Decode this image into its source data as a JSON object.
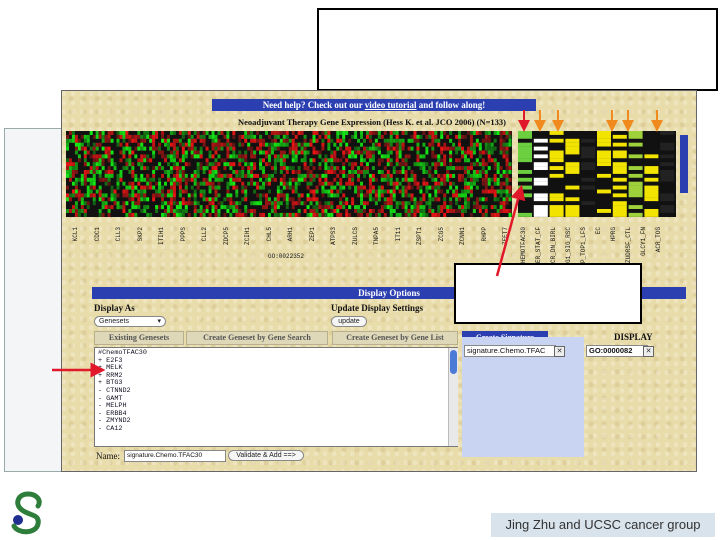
{
  "help_bar": {
    "prefix": "Need help? Check out our ",
    "link": "video tutorial",
    "suffix": " and follow along!"
  },
  "heatmap_title": "Neoadjuvant Therapy Gene Expression (Hess K. et al. JCO 2006) (N=133)",
  "heatmap_labels": [
    "KCL1",
    "CDC1",
    "CLL3",
    "SKP2",
    "ITIH1",
    "PPPS",
    "CLL2",
    "ZDCP5",
    "ZCIH1",
    "CHL5",
    "ARH1",
    "ZEP1",
    "ATPS3",
    "ZULCS",
    "TNPA5",
    "IT11",
    "ZSPT1",
    "ZCG5",
    "ZCNN1",
    "RHPP",
    "ZEET7"
  ],
  "feature_labels": [
    "SCHEMOTFAC30",
    "ER_STAT_CF",
    "ACR_DN_BIRL",
    "ZRG1_SIG_RSC",
    "ARP_TOP1_LFS",
    "EC",
    "HPRG",
    "ZUDRSF_CTL",
    "GLCY1_FN",
    "ACR_TOG"
  ],
  "go_label": "GO:0022352",
  "options": {
    "title": "Display Options",
    "display_as": "Display As",
    "genesets_select": "Genesets",
    "update_settings": "Update Display Settings",
    "update_button": "update",
    "tabs": [
      "Existing Genesets",
      "Create Geneset by Gene Search",
      "Create Geneset by Gene List",
      "Create Signature"
    ],
    "display_header": "DISPLAY",
    "gene_list": [
      "#ChemoTFAC30",
      "+ E2F3",
      "+ MELK",
      "+ RRM2",
      "+ BTG3",
      "- CTNND2",
      "- GAMT",
      "- MELPH",
      "- ERBB4",
      "- ZMYND2",
      "- CA12"
    ],
    "signature_field": "signature.Chemo.TFAC",
    "go_field": "GO:0000082",
    "name_label": "Name:",
    "name_value": "signature.Chemo.TFAC30",
    "validate_button": "Validate & Add ==>"
  },
  "footer": "Jing Zhu and UCSC cancer group",
  "colors": {
    "accent": "#2b3fb0",
    "arrow_red": "#e0182a",
    "arrow_orange": "#f08a1e"
  }
}
